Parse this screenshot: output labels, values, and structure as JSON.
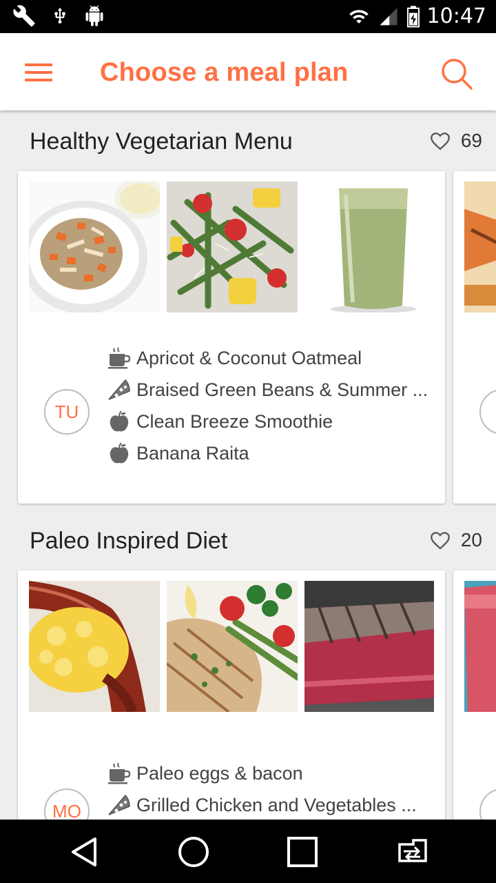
{
  "status": {
    "time": "10:47"
  },
  "appbar": {
    "title": "Choose a meal plan"
  },
  "plans": [
    {
      "title": "Healthy Vegetarian Menu",
      "likes": "69",
      "day": "TU",
      "meals": [
        {
          "icon": "coffee-cup-icon",
          "label": "Apricot & Coconut Oatmeal"
        },
        {
          "icon": "pizza-slice-icon",
          "label": "Braised Green Beans & Summer ..."
        },
        {
          "icon": "apple-icon",
          "label": "Clean Breeze Smoothie"
        },
        {
          "icon": "apple-icon",
          "label": "Banana Raita"
        }
      ]
    },
    {
      "title": "Paleo Inspired Diet",
      "likes": "20",
      "day": "MO",
      "meals": [
        {
          "icon": "coffee-cup-icon",
          "label": "Paleo eggs & bacon"
        },
        {
          "icon": "pizza-slice-icon",
          "label": "Grilled Chicken and Vegetables ..."
        }
      ]
    }
  ],
  "colors": {
    "accent": "#ff7043",
    "text": "#212121"
  }
}
